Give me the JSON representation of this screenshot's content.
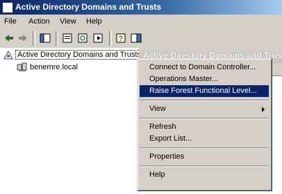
{
  "window": {
    "title": "Active Directory Domains and Trusts"
  },
  "menubar": {
    "items": [
      "File",
      "Action",
      "View",
      "Help"
    ]
  },
  "tree": {
    "root_label": "Active Directory Domains and Trusts",
    "child_label": "benemre.local"
  },
  "right_pane": {
    "header": "Active Directory Domains and Trusts"
  },
  "context_menu": {
    "items": [
      "Connect to Domain Controller...",
      "Operations Master...",
      "Raise Forest Functional Level...",
      "View",
      "Refresh",
      "Export List...",
      "Properties",
      "Help"
    ]
  },
  "colors": {
    "title_gradient_start": "#0a246a",
    "selection": "#0a246a",
    "chrome": "#d4d0c8"
  }
}
